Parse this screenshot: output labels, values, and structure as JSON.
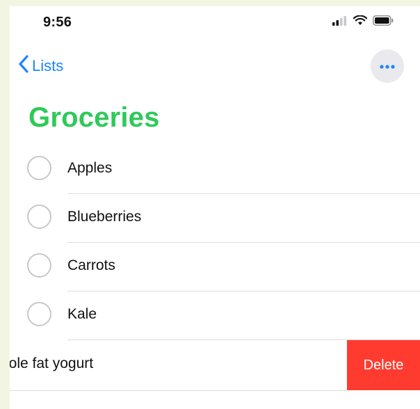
{
  "status_bar": {
    "time": "9:56",
    "icons": [
      "cellular-signal-icon",
      "wifi-icon",
      "battery-icon"
    ]
  },
  "nav": {
    "back_label": "Lists",
    "back_icon": "chevron-left-icon",
    "more_icon": "ellipsis-icon"
  },
  "list": {
    "title": "Groceries",
    "title_color": "#2fc95a",
    "items": [
      {
        "label": "Apples"
      },
      {
        "label": "Blueberries"
      },
      {
        "label": "Carrots"
      },
      {
        "label": "Kale"
      }
    ],
    "swiped_item": {
      "label": "hole fat yogurt",
      "action_label": "Delete",
      "action_color": "#ff3b30"
    }
  },
  "colors": {
    "accent": "#1a84ff",
    "background": "#ffffff"
  }
}
